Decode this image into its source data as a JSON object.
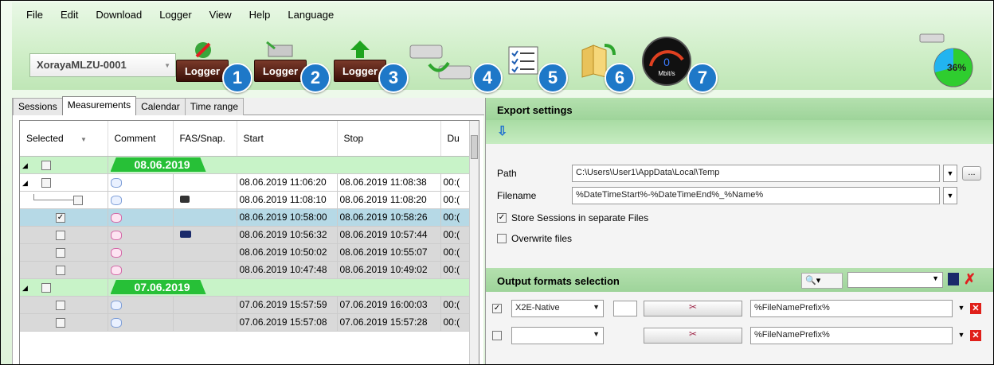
{
  "menu": [
    "File",
    "Edit",
    "Download",
    "Logger",
    "View",
    "Help",
    "Language"
  ],
  "toolbar": {
    "logger_name": "XorayaMLZU-0001",
    "logger_button_label": "Logger",
    "badges": [
      "1",
      "2",
      "3",
      "4",
      "5",
      "6",
      "7"
    ],
    "speed_label": "Mbit/s",
    "speed_value": "0",
    "storage_percent": "36%"
  },
  "tabs": [
    "Sessions",
    "Measurements",
    "Calendar",
    "Time range"
  ],
  "active_tab": "Measurements",
  "grid": {
    "columns": [
      "Selected",
      "Comment",
      "FAS/Snap.",
      "Start",
      "Stop",
      "Du"
    ],
    "rows": [
      {
        "type": "group",
        "date": "08.06.2019"
      },
      {
        "type": "white",
        "start": "08.06.2019 11:06:20",
        "stop": "08.06.2019 11:08:38",
        "dur": "00:("
      },
      {
        "type": "white",
        "start": "08.06.2019 11:08:10",
        "stop": "08.06.2019 11:08:20",
        "dur": "00:("
      },
      {
        "type": "sel",
        "start": "08.06.2019 10:58:00",
        "stop": "08.06.2019 10:58:26",
        "dur": "00:("
      },
      {
        "type": "gray",
        "start": "08.06.2019 10:56:32",
        "stop": "08.06.2019 10:57:44",
        "dur": "00:("
      },
      {
        "type": "gray",
        "start": "08.06.2019 10:50:02",
        "stop": "08.06.2019 10:55:07",
        "dur": "00:("
      },
      {
        "type": "gray",
        "start": "08.06.2019 10:47:48",
        "stop": "08.06.2019 10:49:02",
        "dur": "00:("
      },
      {
        "type": "group",
        "date": "07.06.2019"
      },
      {
        "type": "gray",
        "start": "07.06.2019 15:57:59",
        "stop": "07.06.2019 16:00:03",
        "dur": "00:("
      },
      {
        "type": "gray",
        "start": "07.06.2019 15:57:08",
        "stop": "07.06.2019 15:57:28",
        "dur": "00:("
      }
    ]
  },
  "export": {
    "title": "Export settings",
    "path_label": "Path",
    "path_value": "C:\\Users\\User1\\AppData\\Local\\Temp",
    "filename_label": "Filename",
    "filename_value": "%DateTimeStart%-%DateTimeEnd%_%Name%",
    "store_sessions_label": "Store Sessions in separate Files",
    "overwrite_label": "Overwrite files",
    "ellipsis": "..."
  },
  "output": {
    "title": "Output formats selection",
    "rows": [
      {
        "format": "X2E-Native",
        "prefix": "%FileNamePrefix%"
      },
      {
        "format": "",
        "prefix": "%FileNamePrefix%"
      }
    ]
  }
}
